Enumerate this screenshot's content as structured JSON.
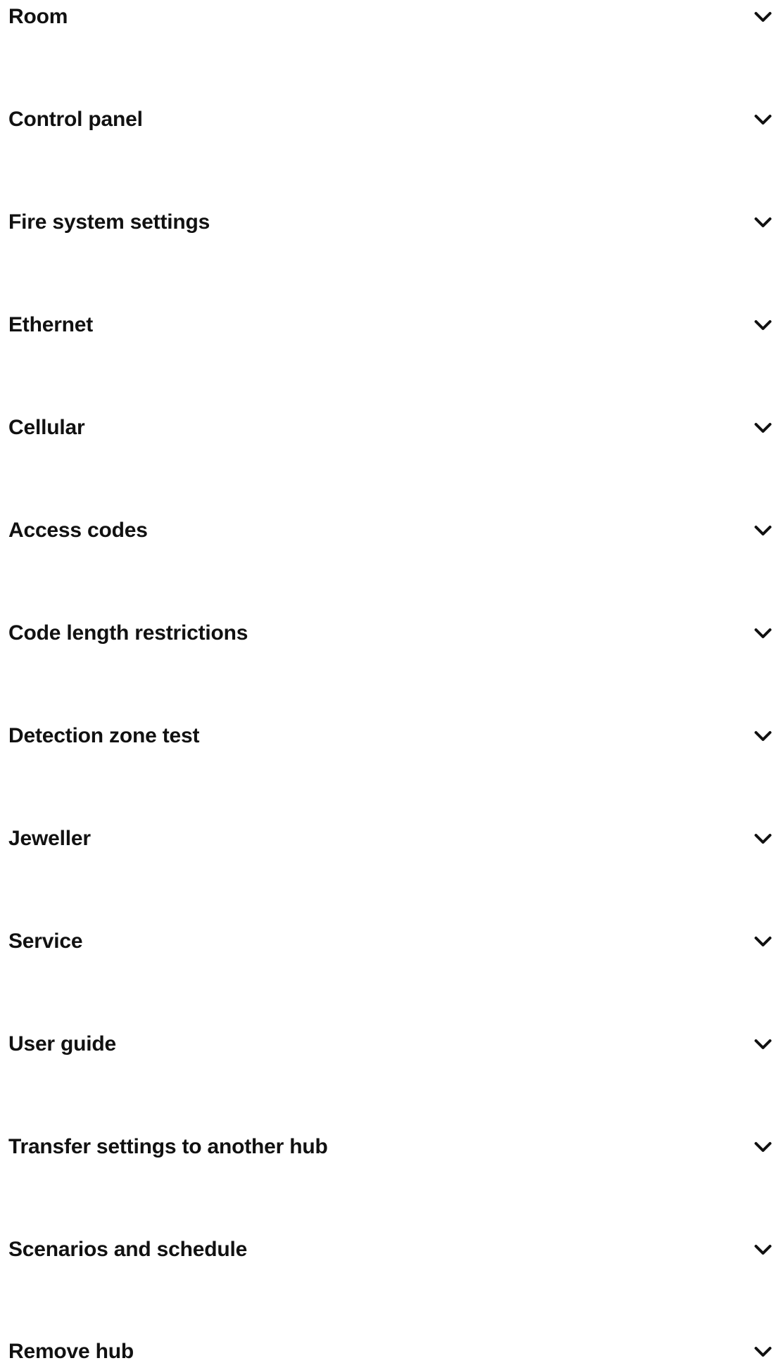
{
  "accordion": {
    "items": [
      {
        "label": "Room",
        "icon": "chevron-down-icon"
      },
      {
        "label": "Control panel",
        "icon": "chevron-down-icon"
      },
      {
        "label": "Fire system settings",
        "icon": "chevron-down-icon"
      },
      {
        "label": "Ethernet",
        "icon": "chevron-down-icon"
      },
      {
        "label": "Cellular",
        "icon": "chevron-down-icon"
      },
      {
        "label": "Access codes",
        "icon": "chevron-down-icon"
      },
      {
        "label": "Code length restrictions",
        "icon": "chevron-down-icon"
      },
      {
        "label": "Detection zone test",
        "icon": "chevron-down-icon"
      },
      {
        "label": "Jeweller",
        "icon": "chevron-down-icon"
      },
      {
        "label": "Service",
        "icon": "chevron-down-icon"
      },
      {
        "label": "User guide",
        "icon": "chevron-down-icon"
      },
      {
        "label": "Transfer settings to another hub",
        "icon": "chevron-down-icon"
      },
      {
        "label": "Scenarios and schedule",
        "icon": "chevron-down-icon"
      },
      {
        "label": "Remove hub",
        "icon": "chevron-down-icon"
      }
    ]
  }
}
